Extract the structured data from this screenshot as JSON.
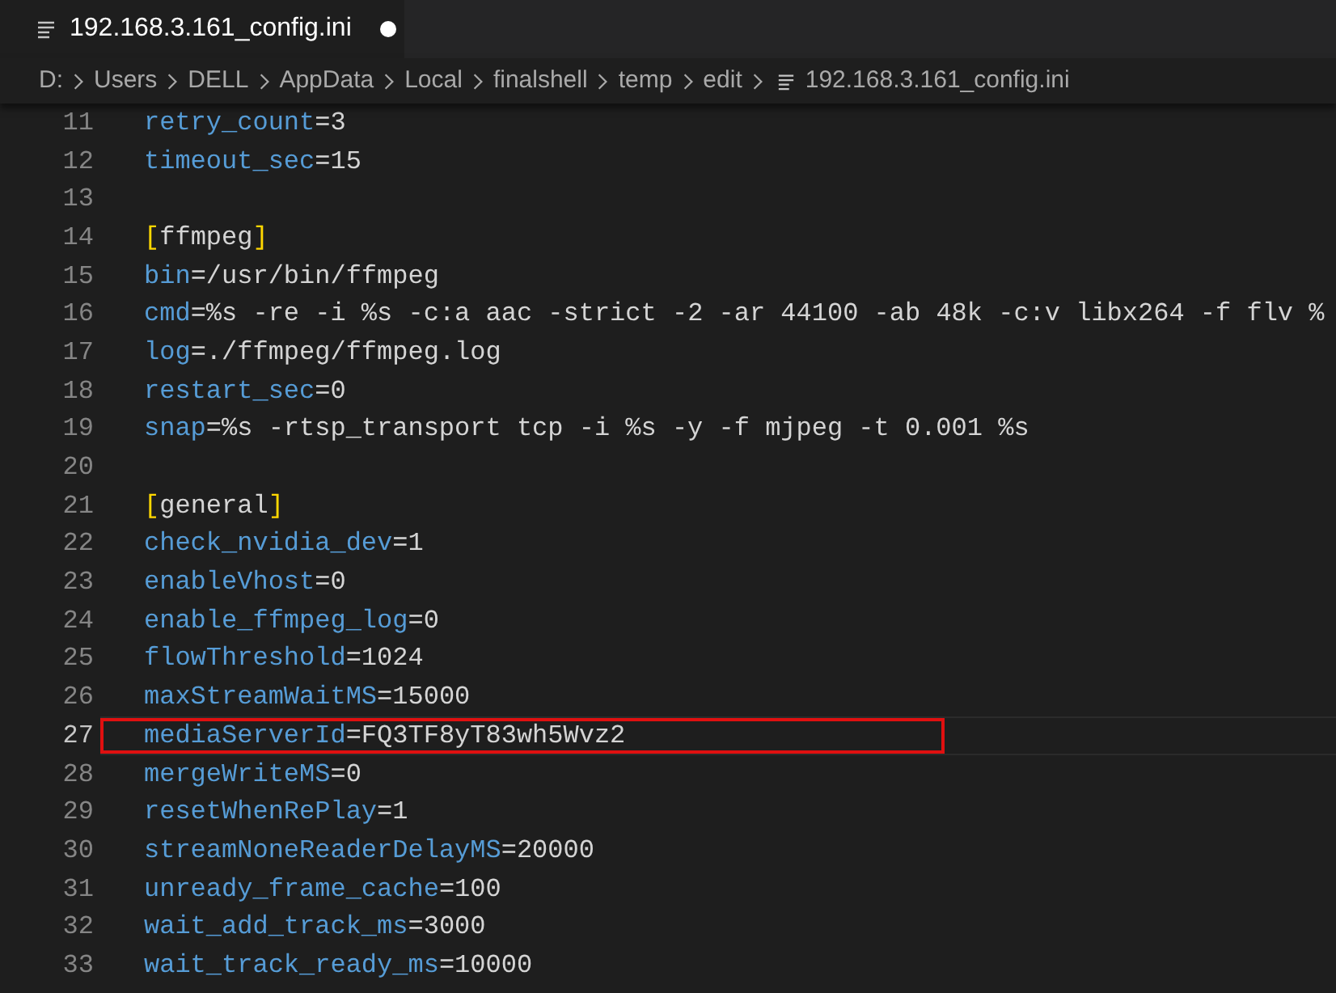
{
  "tab": {
    "title": "192.168.3.161_config.ini",
    "selected": true,
    "modified": true
  },
  "breadcrumb": [
    {
      "label": "D:",
      "kind": "folder"
    },
    {
      "label": "Users",
      "kind": "folder"
    },
    {
      "label": "DELL",
      "kind": "folder"
    },
    {
      "label": "AppData",
      "kind": "folder"
    },
    {
      "label": "Local",
      "kind": "folder"
    },
    {
      "label": "finalshell",
      "kind": "folder"
    },
    {
      "label": "temp",
      "kind": "folder"
    },
    {
      "label": "edit",
      "kind": "folder"
    },
    {
      "label": "192.168.3.161_config.ini",
      "kind": "file"
    }
  ],
  "lines": [
    {
      "number": "11",
      "kind": "pair",
      "text": "retry_count=3",
      "current": false,
      "annotated": false
    },
    {
      "number": "12",
      "kind": "pair",
      "text": "timeout_sec=15",
      "current": false,
      "annotated": false
    },
    {
      "number": "13",
      "kind": "blank",
      "current": false,
      "annotated": false
    },
    {
      "number": "14",
      "kind": "section",
      "text": "[ffmpeg]",
      "current": false,
      "annotated": false
    },
    {
      "number": "15",
      "kind": "pair",
      "text": "bin=/usr/bin/ffmpeg",
      "current": false,
      "annotated": false
    },
    {
      "number": "16",
      "kind": "pair",
      "text": "cmd=%s -re -i %s -c:a aac -strict -2 -ar 44100 -ab 48k -c:v libx264 -f flv %",
      "current": false,
      "annotated": false
    },
    {
      "number": "17",
      "kind": "pair",
      "text": "log=./ffmpeg/ffmpeg.log",
      "current": false,
      "annotated": false
    },
    {
      "number": "18",
      "kind": "pair",
      "text": "restart_sec=0",
      "current": false,
      "annotated": false
    },
    {
      "number": "19",
      "kind": "pair",
      "text": "snap=%s -rtsp_transport tcp -i %s -y -f mjpeg -t 0.001 %s",
      "current": false,
      "annotated": false
    },
    {
      "number": "20",
      "kind": "blank",
      "current": false,
      "annotated": false
    },
    {
      "number": "21",
      "kind": "section",
      "text": "[general]",
      "current": false,
      "annotated": false
    },
    {
      "number": "22",
      "kind": "pair",
      "text": "check_nvidia_dev=1",
      "current": false,
      "annotated": false
    },
    {
      "number": "23",
      "kind": "pair",
      "text": "enableVhost=0",
      "current": false,
      "annotated": false
    },
    {
      "number": "24",
      "kind": "pair",
      "text": "enable_ffmpeg_log=0",
      "current": false,
      "annotated": false
    },
    {
      "number": "25",
      "kind": "pair",
      "text": "flowThreshold=1024",
      "current": false,
      "annotated": false
    },
    {
      "number": "26",
      "kind": "pair",
      "text": "maxStreamWaitMS=15000",
      "current": false,
      "annotated": false
    },
    {
      "number": "27",
      "kind": "pair",
      "text": "mediaServerId=FQ3TF8yT83wh5Wvz2",
      "current": true,
      "annotated": true
    },
    {
      "number": "28",
      "kind": "pair",
      "text": "mergeWriteMS=0",
      "current": false,
      "annotated": false
    },
    {
      "number": "29",
      "kind": "pair",
      "text": "resetWhenRePlay=1",
      "current": false,
      "annotated": false
    },
    {
      "number": "30",
      "kind": "pair",
      "text": "streamNoneReaderDelayMS=20000",
      "current": false,
      "annotated": false
    },
    {
      "number": "31",
      "kind": "pair",
      "text": "unready_frame_cache=100",
      "current": false,
      "annotated": false
    },
    {
      "number": "32",
      "kind": "pair",
      "text": "wait_add_track_ms=3000",
      "current": false,
      "annotated": false
    },
    {
      "number": "33",
      "kind": "pair",
      "text": "wait_track_ready_ms=10000",
      "current": false,
      "annotated": false
    }
  ]
}
